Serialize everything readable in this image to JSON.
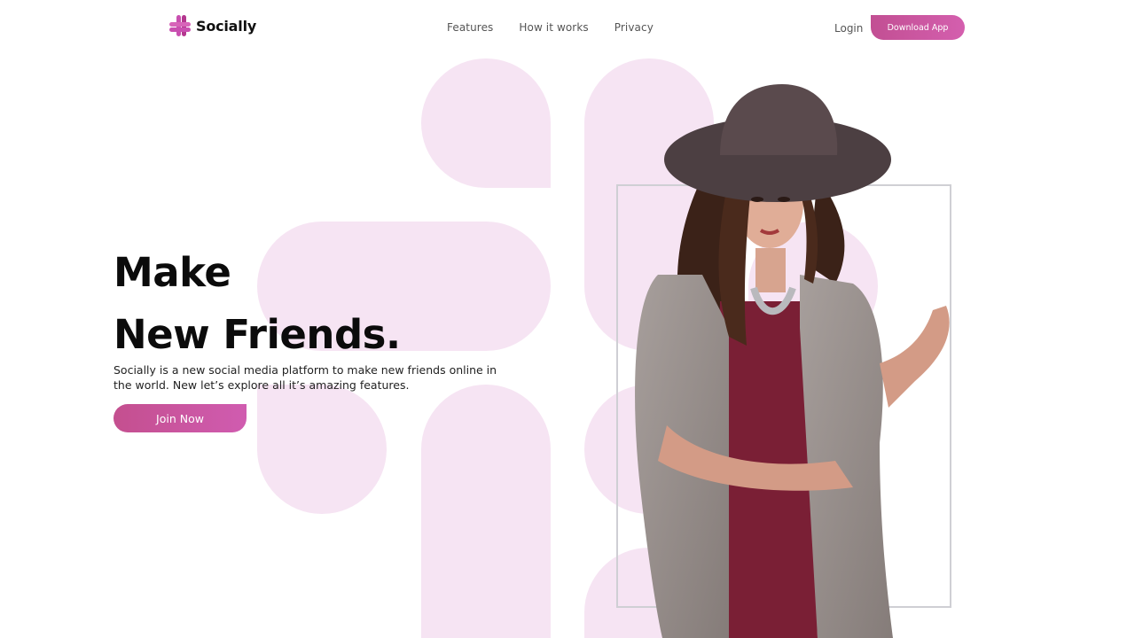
{
  "brand": {
    "name": "Socially",
    "accent": "#c94fb0",
    "shape_tint": "#f6e4f3"
  },
  "nav": {
    "items": [
      {
        "label": "Features"
      },
      {
        "label": "How it works"
      },
      {
        "label": "Privacy"
      }
    ],
    "login_label": "Login",
    "download_label": "Download App"
  },
  "hero": {
    "title_line1": "Make",
    "title_line2": "New Friends.",
    "description": "Socially is a new social media platform to make new friends online in the world. New let’s explore all it’s amazing features.",
    "cta_label": "Join Now"
  }
}
